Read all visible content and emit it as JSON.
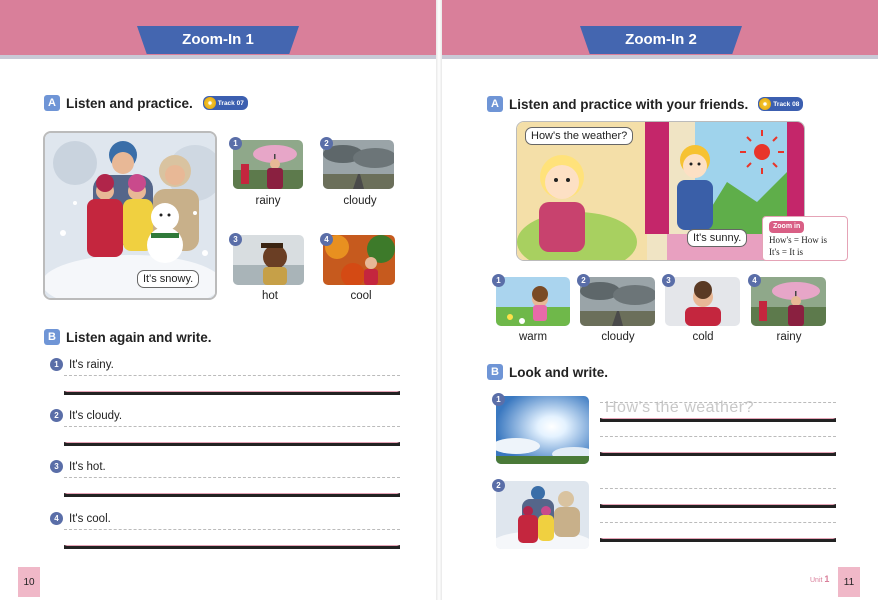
{
  "left_page": {
    "ribbon_title": "Zoom-In 1",
    "section_a": {
      "letter": "A",
      "title": "Listen and practice.",
      "track": "Track 07",
      "main_photo_caption": "It's snowy.",
      "items": [
        {
          "num": "1",
          "label": "rainy"
        },
        {
          "num": "2",
          "label": "cloudy"
        },
        {
          "num": "3",
          "label": "hot"
        },
        {
          "num": "4",
          "label": "cool"
        }
      ]
    },
    "section_b": {
      "letter": "B",
      "title": "Listen again and write.",
      "items": [
        {
          "num": "1",
          "text": "It's rainy."
        },
        {
          "num": "2",
          "text": "It's cloudy."
        },
        {
          "num": "3",
          "text": "It's hot."
        },
        {
          "num": "4",
          "text": "It's cool."
        }
      ]
    },
    "page_number": "10"
  },
  "right_page": {
    "ribbon_title": "Zoom-In 2",
    "section_a": {
      "letter": "A",
      "title": "Listen and practice with your friends.",
      "track": "Track 08",
      "bubble_question": "How's the weather?",
      "bubble_answer": "It's sunny.",
      "zoom_tag": "Zoom in",
      "zoom_lines": [
        "How's = How is",
        "It's = It is"
      ],
      "items": [
        {
          "num": "1",
          "label": "warm"
        },
        {
          "num": "2",
          "label": "cloudy"
        },
        {
          "num": "3",
          "label": "cold"
        },
        {
          "num": "4",
          "label": "rainy"
        }
      ]
    },
    "section_b": {
      "letter": "B",
      "title": "Look and write.",
      "items": [
        {
          "num": "1",
          "trace_text": "How's the weather?"
        },
        {
          "num": "2",
          "trace_text": ""
        }
      ]
    },
    "unit_prefix": "Unit",
    "unit_number": "1",
    "page_number": "11"
  },
  "colors": {
    "band": "#d97f9a",
    "ribbon": "#4466b0",
    "section_letter": "#6f95d6"
  }
}
